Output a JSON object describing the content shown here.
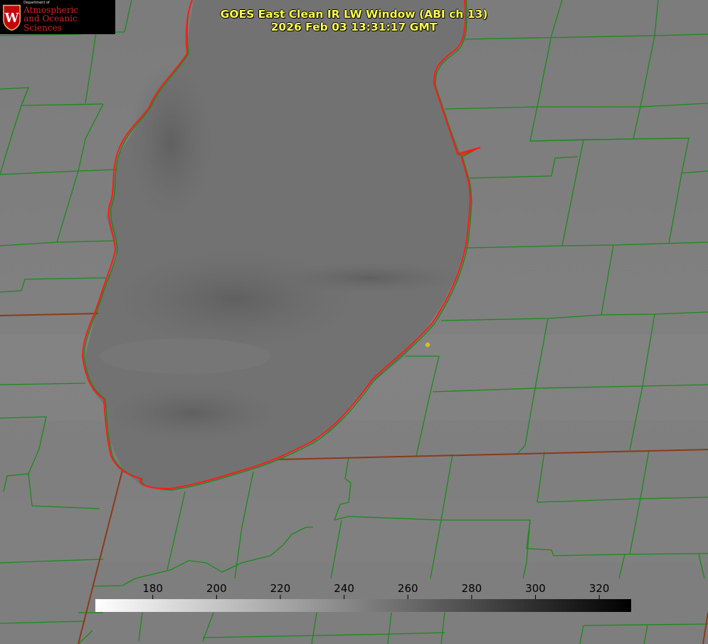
{
  "logo": {
    "department_label": "Department of",
    "line1": "Atmospheric",
    "line2": "and Oceanic Sciences",
    "crest_letter": "W"
  },
  "title": {
    "line1": "GOES East Clean IR LW Window (ABI ch 13)",
    "line2": "2026 Feb 03 13:31:17 GMT",
    "color": "#ffff4d"
  },
  "colorbar": {
    "ticks": [
      {
        "value": 180,
        "label": "180"
      },
      {
        "value": 200,
        "label": "200"
      },
      {
        "value": 220,
        "label": "220"
      },
      {
        "value": 240,
        "label": "240"
      },
      {
        "value": 260,
        "label": "260"
      },
      {
        "value": 280,
        "label": "280"
      },
      {
        "value": 300,
        "label": "300"
      },
      {
        "value": 320,
        "label": "320"
      }
    ],
    "range": [
      162,
      330
    ],
    "gradient_from": "#ffffff",
    "gradient_to": "#000000",
    "label_color": "#000000"
  },
  "map": {
    "county_line_color": "#1a8a1a",
    "state_line_color": "#8b3a1a",
    "lake_outline_color": "#ff1a1a",
    "marker_color": "#d4c21a"
  }
}
